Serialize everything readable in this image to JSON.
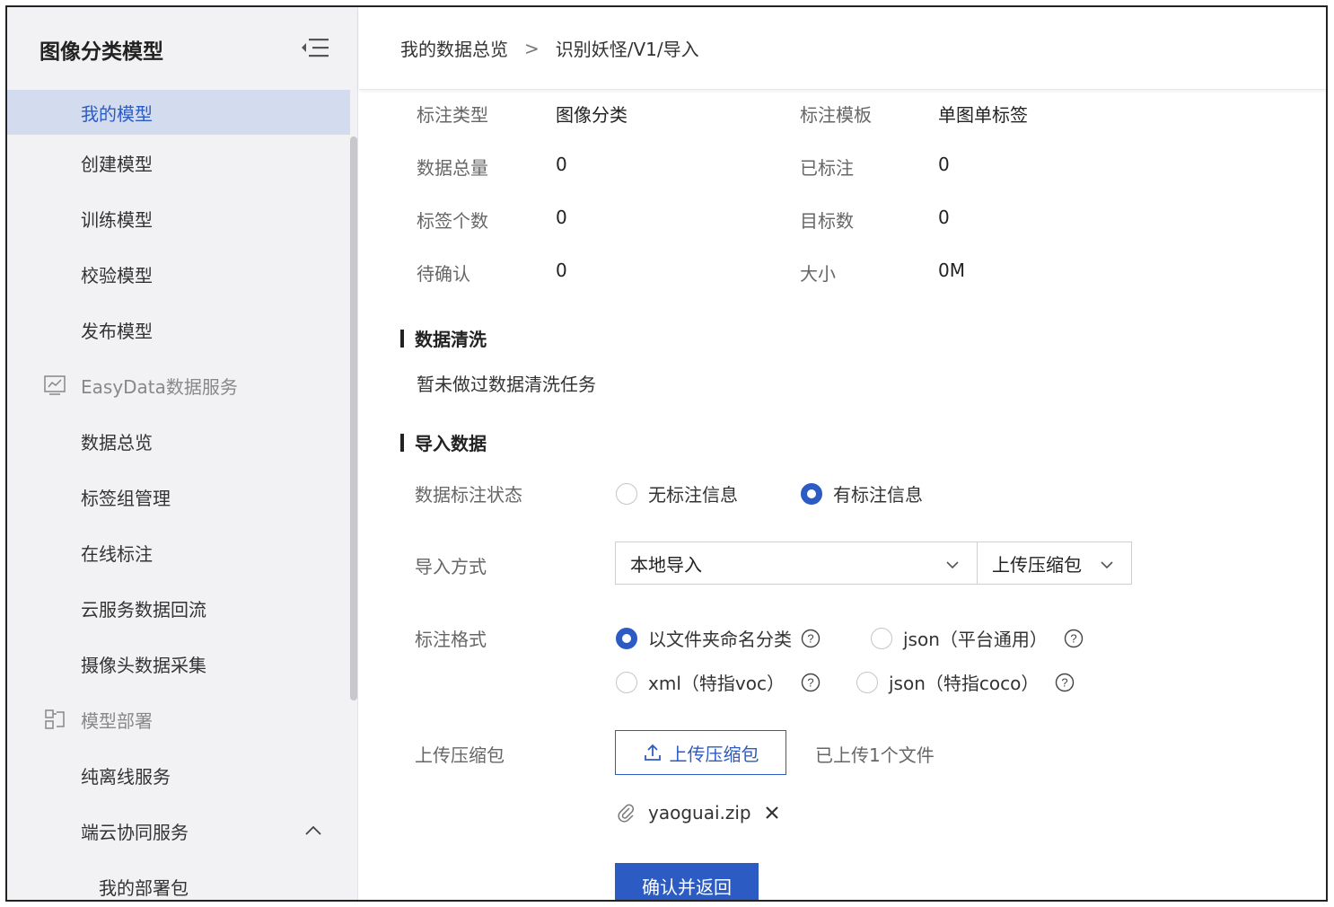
{
  "sidebar": {
    "title": "图像分类模型",
    "items": [
      {
        "label": "我的模型"
      },
      {
        "label": "创建模型"
      },
      {
        "label": "训练模型"
      },
      {
        "label": "校验模型"
      },
      {
        "label": "发布模型"
      },
      {
        "label": "EasyData数据服务",
        "icon": "chart-icon"
      },
      {
        "label": "数据总览"
      },
      {
        "label": "标签组管理"
      },
      {
        "label": "在线标注"
      },
      {
        "label": "云服务数据回流"
      },
      {
        "label": "摄像头数据采集"
      },
      {
        "label": "模型部署",
        "icon": "deploy-icon"
      },
      {
        "label": "纯离线服务"
      },
      {
        "label": "端云协同服务"
      },
      {
        "label": "我的部署包"
      }
    ]
  },
  "breadcrumb": {
    "root": "我的数据总览",
    "separator": ">",
    "current": "识别妖怪/V1/导入"
  },
  "info": {
    "annotation_type_label": "标注类型",
    "annotation_type_value": "图像分类",
    "template_label": "标注模板",
    "template_value": "单图单标签",
    "total_label": "数据总量",
    "total_value": "0",
    "labeled_label": "已标注",
    "labeled_value": "0",
    "tag_count_label": "标签个数",
    "tag_count_value": "0",
    "target_count_label": "目标数",
    "target_count_value": "0",
    "pending_label": "待确认",
    "pending_value": "0",
    "size_label": "大小",
    "size_value": "0M"
  },
  "cleaning": {
    "title": "数据清洗",
    "note": "暂未做过数据清洗任务"
  },
  "import": {
    "title": "导入数据",
    "status_label": "数据标注状态",
    "status_options": [
      "无标注信息",
      "有标注信息"
    ],
    "status_selected": "有标注信息",
    "method_label": "导入方式",
    "method_value": "本地导入",
    "method_sub_value": "上传压缩包",
    "format_label": "标注格式",
    "format_options": [
      "以文件夹命名分类",
      "json（平台通用）",
      "xml（特指voc）",
      "json（特指coco）"
    ],
    "format_selected": "以文件夹命名分类",
    "upload_label": "上传压缩包",
    "upload_button": "上传压缩包",
    "upload_status": "已上传1个文件",
    "file_name": "yaoguai.zip",
    "confirm_button": "确认并返回"
  },
  "colors": {
    "accent": "#2d5bc4",
    "sidebar_bg": "#f2f2f4",
    "sidebar_active_bg": "#d3dcee"
  }
}
